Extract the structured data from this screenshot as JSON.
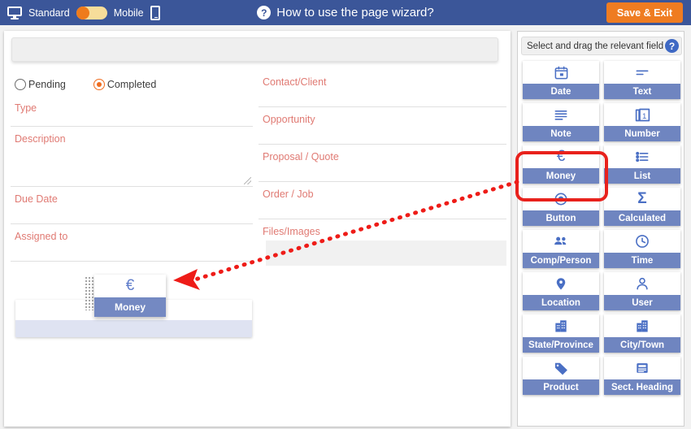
{
  "topbar": {
    "monitor_icon": "desktop-monitor-icon",
    "standard_label": "Standard",
    "toggle_state": "standard",
    "mobile_label": "Mobile",
    "phone_icon": "mobile-phone-icon",
    "help_icon": "question-mark-icon",
    "help_text": "How to use the page wizard?",
    "save_label": "Save & Exit",
    "bg_color": "#3b5699",
    "save_color": "#ef7c21",
    "toggle_knob_color": "#ee7b1c"
  },
  "form": {
    "status_options": [
      {
        "label": "Pending",
        "selected": false
      },
      {
        "label": "Completed",
        "selected": true
      }
    ],
    "selected_color": "#ef6c1f",
    "label_color": "#e07a73",
    "left_fields": [
      {
        "label": "Type"
      },
      {
        "label": "Description"
      },
      {
        "label": "Due Date"
      },
      {
        "label": "Assigned to"
      }
    ],
    "right_fields": [
      {
        "label": "Contact/Client"
      },
      {
        "label": "Opportunity"
      },
      {
        "label": "Proposal / Quote"
      },
      {
        "label": "Order / Job"
      },
      {
        "label": "Files/Images"
      }
    ],
    "drop_zone_color": "#dfe3f2"
  },
  "drag_ghost": {
    "icon": "euro-currency-icon",
    "glyph": "€",
    "label": "Money",
    "handle_icon": "drag-handle-dots-icon"
  },
  "palette": {
    "header_text": "Select and drag the relevant field",
    "help_icon": "question-mark-icon",
    "tile_label_color": "#6f85c0",
    "tile_icon_color": "#4a6fc4",
    "highlight_color": "#e8211c",
    "highlighted_tile": "Money",
    "tiles": [
      {
        "label": "Date",
        "icon": "calendar-icon"
      },
      {
        "label": "Text",
        "icon": "text-lines-icon"
      },
      {
        "label": "Note",
        "icon": "note-lines-icon"
      },
      {
        "label": "Number",
        "icon": "number-box-icon"
      },
      {
        "label": "Money",
        "icon": "euro-currency-icon"
      },
      {
        "label": "List",
        "icon": "bullet-list-icon"
      },
      {
        "label": "Button",
        "icon": "radio-button-icon"
      },
      {
        "label": "Calculated",
        "icon": "sigma-sum-icon"
      },
      {
        "label": "Comp/Person",
        "icon": "people-group-icon"
      },
      {
        "label": "Time",
        "icon": "clock-icon"
      },
      {
        "label": "Location",
        "icon": "map-pin-icon"
      },
      {
        "label": "User",
        "icon": "person-icon"
      },
      {
        "label": "State/Province",
        "icon": "building-icon"
      },
      {
        "label": "City/Town",
        "icon": "building-icon"
      },
      {
        "label": "Product",
        "icon": "price-tag-icon"
      },
      {
        "label": "Sect. Heading",
        "icon": "section-heading-icon"
      }
    ]
  },
  "annotation": {
    "arrow_color": "#ee1c18",
    "arrow_style": "dotted-arrow-pointing-left"
  }
}
